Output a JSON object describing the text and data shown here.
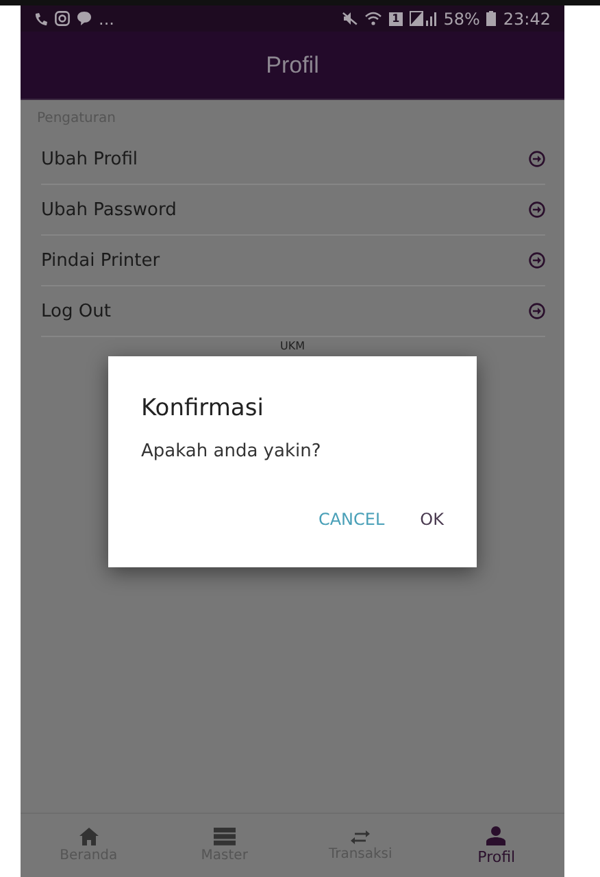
{
  "status_bar": {
    "more": "...",
    "sim": "1",
    "battery": "58%",
    "time": "23:42"
  },
  "header": {
    "title": "Profil"
  },
  "section": {
    "title": "Pengaturan"
  },
  "menu": [
    {
      "label": "Ubah Profil"
    },
    {
      "label": "Ubah Password"
    },
    {
      "label": "Pindai Printer"
    },
    {
      "label": "Log Out"
    }
  ],
  "footer_label": "UKM",
  "dialog": {
    "title": "Konfirmasi",
    "message": "Apakah anda yakin?",
    "buttons": [
      {
        "label": "CANCEL",
        "kind": "cancel"
      },
      {
        "label": "OK",
        "kind": "ok"
      }
    ]
  },
  "bottom_nav": [
    {
      "label": "Beranda",
      "kind": "home",
      "selected": false
    },
    {
      "label": "Master",
      "kind": "list",
      "selected": false
    },
    {
      "label": "Transaksi",
      "kind": "swap",
      "selected": false
    },
    {
      "label": "Profil",
      "kind": "person",
      "selected": true
    }
  ]
}
